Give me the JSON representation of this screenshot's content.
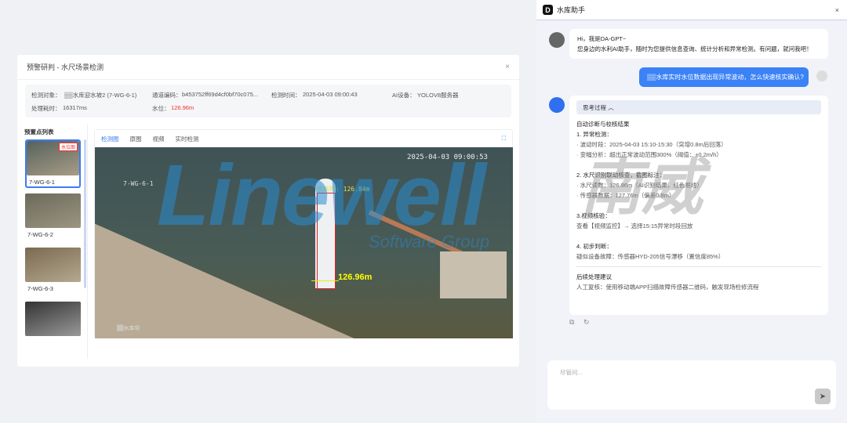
{
  "modal": {
    "title": "预警研判 - 水尺场景检测",
    "close": "×",
    "info": {
      "object_label": "检测对象：",
      "object_value": "▒▒水库迎水坡2 (7-WG-6-1)",
      "channel_label": "通道编码：",
      "channel_value": "b453752ff69d4cf0bf70c075...",
      "time_label": "检测时间：",
      "time_value": "2025-04-03 09:00:43",
      "device_label": "AI设备：",
      "device_value": "YOLOV8服务器",
      "duration_label": "处理耗时：",
      "duration_value": "16317ms",
      "level_label": "水位：",
      "level_value": "126.96m"
    },
    "list_title": "预置点列表",
    "points": [
      {
        "label": "7-WG-6-1",
        "tag": "水位图"
      },
      {
        "label": "7-WG-6-2"
      },
      {
        "label": "7-WG-6-3"
      },
      {
        "label": ""
      }
    ],
    "tabs": [
      "检测图",
      "原图",
      "视频",
      "实时检测"
    ],
    "fullscreen": "⛶",
    "photo": {
      "timestamp": "2025-04-03 09:00:53",
      "camera": "7-WG-6-1",
      "elev": "底高程: 126.84m",
      "level": "126.96m",
      "site": "▒▒水库坝"
    }
  },
  "watermark": {
    "brand": "Linewell",
    "sub": "Software Group",
    "cn": "南威",
    "r": "®"
  },
  "chat": {
    "title": "水库助手",
    "logo": "D",
    "close": "×",
    "greeting": [
      "Hi，我是DA-GPT~",
      "您身边的水利AI助手，随时为您提供信息查询、统计分析和异常检测。有问题，就问我吧！"
    ],
    "user_msg": "▒▒水库实时水位数据出现异常波动，怎么快速核实确认?",
    "think_label": "思考过程 ︿",
    "answer": [
      "自动诊断与校核结果",
      "1. 异常检测：",
      "· 波动时段：2025-04-03 15:10-15:30（突增0.8m后回落）",
      "· 变幅分析：超出正常波动范围300%（阈值：±0.2m/h）",
      "2. 水尺识别联动核查，截图标注：",
      "· 水尺读数：126.96m（AI识别结果，红色框线）",
      "· 传感器数据：127.76m（偏差0.8m）",
      "3.视频核验：",
      "查看【视频监控】→ 选择15:15异常时段回放",
      "4. 初步判断：",
      "疑似设备故障：传感器HYD-205信号漂移（置信度85%）"
    ],
    "followup_title": "后续处理建议",
    "followup": "人工复核：使用移动端APP扫描故障传感器二维码，触发现场检修流程",
    "input_placeholder": "尽管问...",
    "send": "➤"
  }
}
